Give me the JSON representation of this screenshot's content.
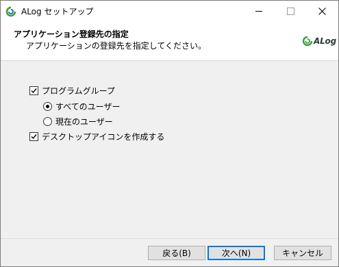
{
  "window": {
    "title": "ALog セットアップ"
  },
  "header": {
    "title": "アプリケーション登録先の指定",
    "subtitle": "アプリケーションの登録先を指定してください。",
    "brand": "ALog"
  },
  "options": {
    "program_group": {
      "label": "プログラムグループ",
      "checked": true
    },
    "all_users": {
      "label": "すべてのユーザー",
      "selected": true
    },
    "current_user": {
      "label": "現在のユーザー",
      "selected": false
    },
    "desktop_icon": {
      "label": "デスクトップアイコンを作成する",
      "checked": true
    }
  },
  "buttons": {
    "back": "戻る(B)",
    "next": "次へ(N)",
    "cancel": "キャンセル"
  },
  "colors": {
    "accent": "#0078d7",
    "brand_green": "#3a9d3a"
  }
}
